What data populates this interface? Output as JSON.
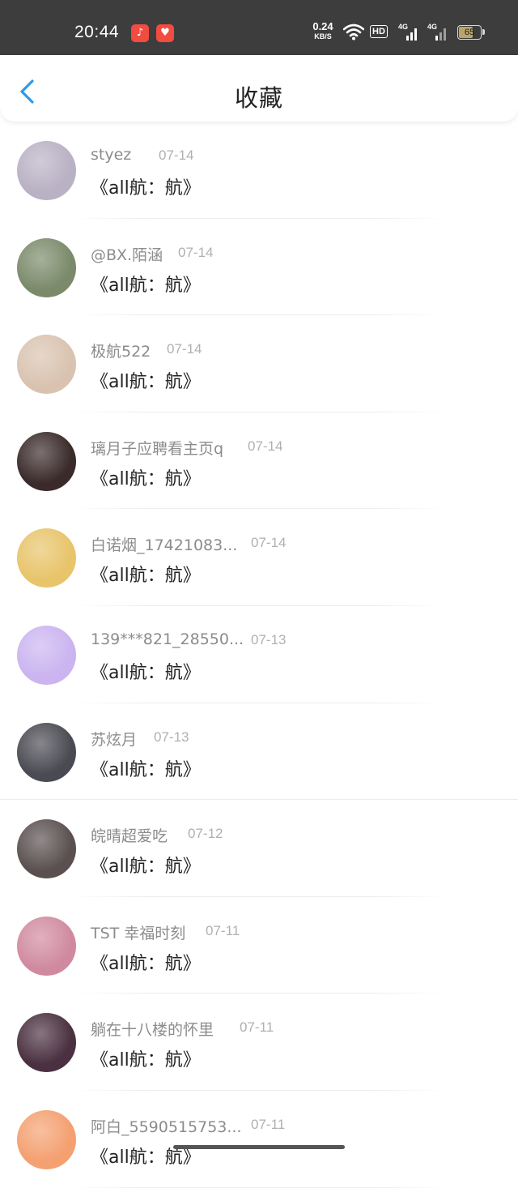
{
  "status_bar": {
    "time": "20:44",
    "net_speed": "0.24",
    "net_unit": "KB/S",
    "hd_label": "HD",
    "sig1_label": "4G",
    "sig2_label": "4G",
    "battery": "65",
    "app_icons": [
      "music-app-icon",
      "heart-app-icon"
    ]
  },
  "header": {
    "title": "收藏",
    "back_icon": "chevron-left-icon"
  },
  "items": [
    {
      "name": "styez",
      "date": "07-14",
      "content": "《all航：航》",
      "avatar_color": "#b9b1c4"
    },
    {
      "name": "@BX.陌涵",
      "date": "07-14",
      "content": "《all航：航》",
      "avatar_color": "#7a8a6a"
    },
    {
      "name": "极航522",
      "date": "07-14",
      "content": "《all航：航》",
      "avatar_color": "#d9c3b0"
    },
    {
      "name": "璃月子应聘看主页q",
      "date": "07-14",
      "content": "《all航：航》",
      "avatar_color": "#3a2a2a"
    },
    {
      "name": "白诺烟_17421083...",
      "date": "07-14",
      "content": "《all航：航》",
      "avatar_color": "#e8c46a"
    },
    {
      "name": "139***821_28550...",
      "date": "07-13",
      "content": "《all航：航》",
      "avatar_color": "#cbb4f0"
    },
    {
      "name": "苏炫月",
      "date": "07-13",
      "content": "《all航：航》",
      "avatar_color": "#4a4a52"
    },
    {
      "name": "皖晴超爱吃",
      "date": "07-12",
      "content": "《all航：航》",
      "avatar_color": "#5a5050"
    },
    {
      "name": "TST 幸福时刻",
      "date": "07-11",
      "content": "《all航：航》",
      "avatar_color": "#d08aa0"
    },
    {
      "name": "躺在十八楼的怀里",
      "date": "07-11",
      "content": "《all航：航》",
      "avatar_color": "#4a3040"
    },
    {
      "name": "阿白_5590515753...",
      "date": "07-11",
      "content": "《all航：航》",
      "avatar_color": "#f4a070"
    }
  ]
}
